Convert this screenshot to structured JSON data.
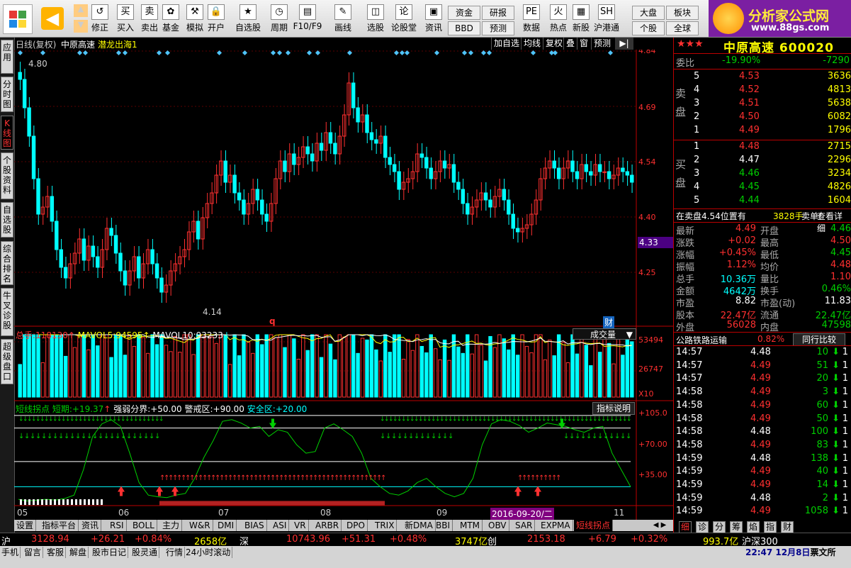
{
  "toolbar": {
    "buttons": [
      "修正",
      "买入",
      "卖出",
      "基金",
      "模拟",
      "开户",
      "自选股",
      "周期",
      "F10/F9",
      "画线",
      "选股",
      "论股堂",
      "资讯",
      "数据",
      "热点",
      "新股",
      "沪港通"
    ],
    "small_buttons": [
      "资金",
      "BBD",
      "研报",
      "预测",
      "大盘",
      "个股",
      "板块",
      "全球"
    ],
    "logo_title": "分析家公式网",
    "logo_url": "www.88gs.com"
  },
  "sidebar": {
    "tabs": [
      "应用",
      "分时图",
      "K线图",
      "个股资料",
      "自选股",
      "综合排名",
      "牛叉诊股",
      "超级盘口"
    ]
  },
  "chart": {
    "header_left": "日线(复权)",
    "stock_name": "中原高速",
    "indicator_name": "潜龙出海1",
    "header_buttons": [
      "加自选",
      "均线",
      "复权",
      "叠",
      "窗",
      "预测"
    ],
    "price_axis": [
      "4.84",
      "4.69",
      "4.54",
      "4.40",
      "4.25"
    ],
    "current_price_tag": "4.33",
    "high_label": "4.80",
    "low_label": "4.14",
    "q_marker": "q",
    "cai_marker": "财",
    "volume_header": {
      "label": "总手:",
      "value": "118130",
      "mavol5_label": "MAVOL5:",
      "mavol5": "94595",
      "mavol10_label": "MAVOL10:",
      "mavol10": "93233"
    },
    "volume_select": "成交量",
    "volume_axis": [
      "53494",
      "26747",
      "X10"
    ],
    "osc_header": {
      "name": "短线拐点",
      "short_label": "短期:",
      "short_value": "+19.37",
      "strong_label": "强弱分界:",
      "strong_value": "+50.00",
      "warn_label": "警戒区:",
      "warn_value": "+90.00",
      "safe_label": "安全区:",
      "safe_value": "+20.00"
    },
    "osc_button": "指标说明",
    "osc_axis": [
      "+105.0",
      "+70.00",
      "+35.00"
    ],
    "date_labels": [
      "05",
      "06",
      "07",
      "08",
      "09",
      "11"
    ],
    "date_highlight": "2016-09-20/二"
  },
  "chart_data": {
    "type": "candlestick",
    "title": "中原高速",
    "ylim": [
      4.1,
      4.86
    ],
    "high": 4.8,
    "low": 4.14,
    "x_months": [
      "05",
      "06",
      "07",
      "08",
      "09",
      "11"
    ],
    "last_close": 4.49
  },
  "quote": {
    "stars": "★★★",
    "name": "中原高速",
    "code": "600020",
    "weibi_label": "委比",
    "weibi_pct": "-19.90%",
    "weibi_diff": "-7290",
    "sell_label": "卖盘",
    "buy_label": "买盘",
    "sells": [
      {
        "lv": "5",
        "price": "4.53",
        "vol": "3636"
      },
      {
        "lv": "4",
        "price": "4.52",
        "vol": "4813"
      },
      {
        "lv": "3",
        "price": "4.51",
        "vol": "5638"
      },
      {
        "lv": "2",
        "price": "4.50",
        "vol": "6082"
      },
      {
        "lv": "1",
        "price": "4.49",
        "vol": "1796"
      }
    ],
    "buys": [
      {
        "lv": "1",
        "price": "4.48",
        "vol": "2715"
      },
      {
        "lv": "2",
        "price": "4.47",
        "vol": "2296"
      },
      {
        "lv": "3",
        "price": "4.46",
        "vol": "3234"
      },
      {
        "lv": "4",
        "price": "4.45",
        "vol": "4826"
      },
      {
        "lv": "5",
        "price": "4.44",
        "vol": "1604"
      }
    ],
    "notice_a": "在卖盘4.54位置有",
    "notice_b": "3828手",
    "notice_c": "卖单!",
    "notice_link": "查看详细",
    "stats_left": [
      {
        "label": "最新",
        "value": "4.49"
      },
      {
        "label": "涨跌",
        "value": "+0.02"
      },
      {
        "label": "涨幅",
        "value": "+0.45%"
      },
      {
        "label": "振幅",
        "value": "1.12%"
      },
      {
        "label": "总手",
        "value": "10.36万"
      },
      {
        "label": "金额",
        "value": "4642万"
      },
      {
        "label": "市盈",
        "value": "8.82"
      },
      {
        "label": "股本",
        "value": "22.47亿"
      },
      {
        "label": "外盘",
        "value": "56028"
      }
    ],
    "stats_right": [
      {
        "label": "开盘",
        "value": "4.46"
      },
      {
        "label": "最高",
        "value": "4.50"
      },
      {
        "label": "最低",
        "value": "4.45"
      },
      {
        "label": "均价",
        "value": "4.48"
      },
      {
        "label": "量比",
        "value": "1.10"
      },
      {
        "label": "换手",
        "value": "0.46%"
      },
      {
        "label": "市盈(动)",
        "value": "11.83"
      },
      {
        "label": "流通",
        "value": "22.47亿"
      },
      {
        "label": "内盘",
        "value": "47598"
      }
    ],
    "industry": "公路铁路运输",
    "industry_pct": "0.82%",
    "industry_btn": "同行比较",
    "ticks": [
      {
        "t": "14:57",
        "p": "4.48",
        "v": "10",
        "d": "down"
      },
      {
        "t": "14:57",
        "p": "4.49",
        "v": "51",
        "d": "down"
      },
      {
        "t": "14:57",
        "p": "4.49",
        "v": "20",
        "d": "down"
      },
      {
        "t": "14:58",
        "p": "4.49",
        "v": "3",
        "d": "down"
      },
      {
        "t": "14:58",
        "p": "4.49",
        "v": "60",
        "d": "down"
      },
      {
        "t": "14:58",
        "p": "4.49",
        "v": "50",
        "d": "down"
      },
      {
        "t": "14:58",
        "p": "4.48",
        "v": "100",
        "d": "down"
      },
      {
        "t": "14:58",
        "p": "4.49",
        "v": "83",
        "d": "down"
      },
      {
        "t": "14:59",
        "p": "4.48",
        "v": "138",
        "d": "down"
      },
      {
        "t": "14:59",
        "p": "4.49",
        "v": "40",
        "d": "down"
      },
      {
        "t": "14:59",
        "p": "4.49",
        "v": "14",
        "d": "down"
      },
      {
        "t": "14:59",
        "p": "4.48",
        "v": "2",
        "d": "down"
      },
      {
        "t": "14:59",
        "p": "4.49",
        "v": "1058",
        "d": "down"
      }
    ],
    "tick_side": [
      "1",
      "1",
      "1",
      "1",
      "1",
      "1",
      "1",
      "1",
      "1",
      "1",
      "1",
      "1",
      "1"
    ],
    "right_tabs": [
      "细",
      "诊",
      "分",
      "筹",
      "焰",
      "指",
      "财"
    ]
  },
  "bottom_tabs": [
    "设置",
    "指标平台",
    "资讯",
    "RSI",
    "BOLL",
    "主力",
    "W&R",
    "DMI",
    "BIAS",
    "ASI",
    "VR",
    "ARBR",
    "DPO",
    "TRIX",
    "新DMA",
    "BBI",
    "MTM",
    "OBV",
    "SAR",
    "EXPMA",
    "短线拐点"
  ],
  "index_bar": {
    "sh_label": "沪",
    "sh": "3128.94",
    "sh_chg": "+26.21",
    "sh_pct": "+0.84%",
    "sh_amt": "2658亿",
    "sz_label": "深",
    "sz": "10743.96",
    "sz_chg": "+51.31",
    "sz_pct": "+0.48%",
    "sz_amt": "3747亿",
    "cy_label": "创",
    "cy": "2153.18",
    "cy_chg": "+6.79",
    "cy_pct": "+0.32%",
    "hs_amt": "993.7亿",
    "hs_label": "沪深300"
  },
  "status_bar": {
    "items": [
      "手机",
      "留言",
      "客服",
      "解盘",
      "股市日记",
      "股灵通",
      "行情",
      "24小时滚动"
    ],
    "clock": "22:47 12月8日",
    "clock_tail": "票文所"
  },
  "colors": {
    "up": "#ff3030",
    "down": "#00ffff",
    "volume_up": "#ff3030",
    "volume_down": "#00ffff",
    "oscillator": "#00d000"
  }
}
